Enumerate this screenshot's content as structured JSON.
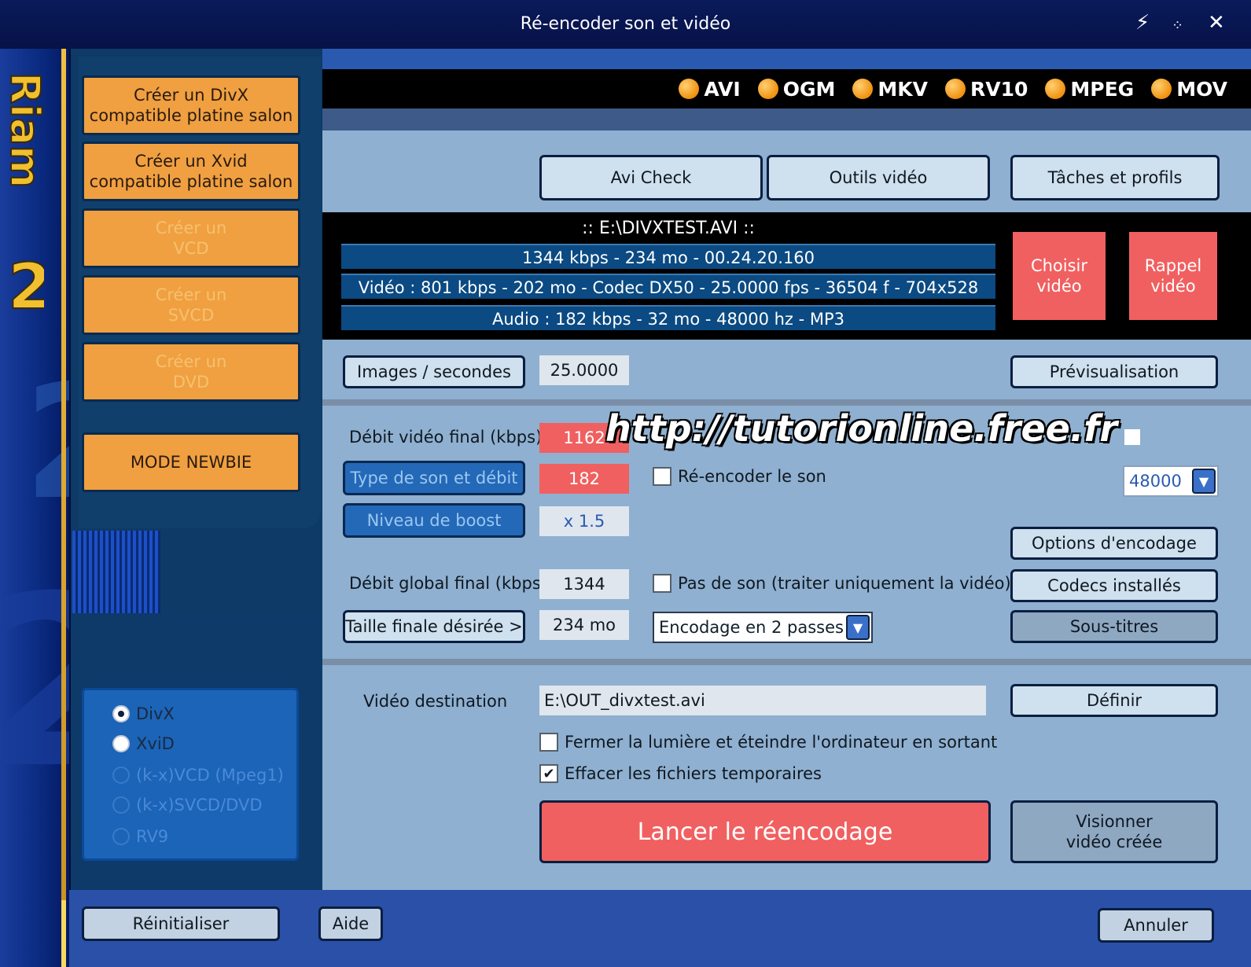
{
  "window": {
    "title": "Ré-encoder son et vidéo",
    "controls": [
      "pin-icon",
      "dots-icon",
      "close-icon"
    ]
  },
  "branding": {
    "logo_text": "Riam",
    "version": "2"
  },
  "colors": {
    "orange": "#f0a040",
    "red": "#f06060",
    "panel": "#8fb0d0",
    "navy": "#0e3a68"
  },
  "sidebar": {
    "buttons": [
      {
        "label": "Créer un DivX\ncompatible platine salon",
        "enabled": true
      },
      {
        "label": "Créer un Xvid\ncompatible platine salon",
        "enabled": true
      },
      {
        "label": "Créer un\nVCD",
        "enabled": false
      },
      {
        "label": "Créer un\nSVCD",
        "enabled": false
      },
      {
        "label": "Créer un\nDVD",
        "enabled": false
      }
    ],
    "newbie_label": "MODE NEWBIE",
    "codecs": [
      {
        "label": "DivX",
        "selected": true,
        "enabled": true
      },
      {
        "label": "XviD",
        "selected": false,
        "enabled": true
      },
      {
        "label": "(k-x)VCD (Mpeg1)",
        "selected": false,
        "enabled": false
      },
      {
        "label": "(k-x)SVCD/DVD",
        "selected": false,
        "enabled": false
      },
      {
        "label": "RV9",
        "selected": false,
        "enabled": false
      }
    ]
  },
  "formats": [
    "AVI",
    "OGM",
    "MKV",
    "RV10",
    "MPEG",
    "MOV"
  ],
  "tools": {
    "avi_check": "Avi Check",
    "outils_video": "Outils vidéo",
    "taches_profils": "Tâches et profils"
  },
  "file_info": {
    "name": ":: E:\\DIVXTEST.AVI ::",
    "summary": "1344 kbps - 234 mo - 00.24.20.160",
    "video": "Vidéo : 801 kbps - 202 mo - Codec DX50 - 25.0000 fps - 36504 f - 704x528",
    "audio": "Audio : 182 kbps - 32 mo - 48000 hz - MP3",
    "choose_label": "Choisir\nvidéo",
    "recall_label": "Rappel\nvidéo"
  },
  "fps": {
    "button": "Images / secondes",
    "value": "25.0000",
    "preview": "Prévisualisation"
  },
  "encoding": {
    "video_bitrate_label": "Débit vidéo final (kbps)",
    "video_bitrate_value": "1162",
    "watermark": "http://tutorionline.free.fr",
    "sound_type_button": "Type de son et débit",
    "sound_bitrate_value": "182",
    "reencode_sound_label": "Ré-encoder le son",
    "reencode_sound_checked": false,
    "sample_rate": "48000",
    "boost_button": "Niveau de boost",
    "boost_value": "x 1.5",
    "options_button": "Options d'encodage",
    "global_bitrate_label": "Débit global final (kbps)",
    "global_bitrate_value": "1344",
    "no_sound_label": "Pas de son (traiter uniquement la vidéo)",
    "no_sound_checked": false,
    "codecs_button": "Codecs installés",
    "target_size_button": "Taille finale désirée >",
    "target_size_value": "234 mo",
    "pass_mode": "Encodage en 2 passes",
    "subtitles_button": "Sous-titres"
  },
  "destination": {
    "label": "Vidéo destination",
    "path": "E:\\OUT_divxtest.avi",
    "define_button": "Définir",
    "shutdown_label": "Fermer la lumière et éteindre l'ordinateur en sortant",
    "shutdown_checked": false,
    "delete_temp_label": "Effacer les fichiers temporaires",
    "delete_temp_checked": true,
    "launch_button": "Lancer le réencodage",
    "view_button": "Visionner\nvidéo créée"
  },
  "footer": {
    "reset": "Réinitialiser",
    "help": "Aide",
    "cancel": "Annuler"
  }
}
